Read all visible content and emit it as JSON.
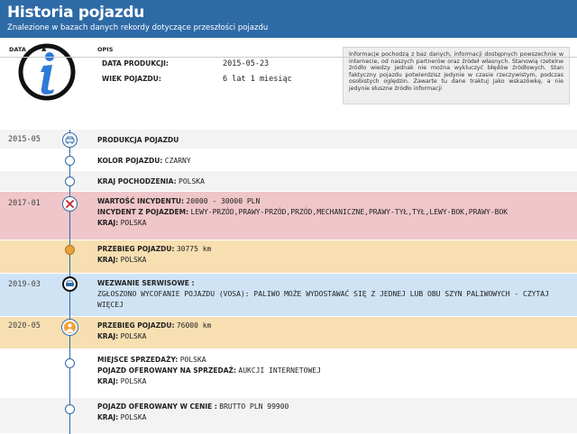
{
  "header": {
    "title": "Historia pojazdu",
    "subtitle": "Znalezione w bazach danych rekordy dotyczące przeszłości pojazdu"
  },
  "vehicle": {
    "production_label": "DATA PRODUKCJI:",
    "production_value": "2015-05-23",
    "age_label": "WIEK POJAZDU:",
    "age_value": "6 lat 1 miesiąc"
  },
  "notice": "Informacje pochodzą z baz danych, informacji dostępnych powszechnie w internecie, od naszych partnerów oraz źródeł własnych. Stanowią rzetelne źródło wiedzy jednak nie można wykluczyć błędów źródłowych. Stan faktyczny pojazdu potwierdzisz jedynie w czasie rzeczywistym, podczas osobistych oględzin. Zawarte tu dane traktuj jako wskazówkę, a nie jedynie słuszne źródło informacji",
  "table": {
    "col_date": "DATA",
    "sort_icon": "sort-up-icon",
    "col_desc": "OPIS"
  },
  "events": [
    {
      "date": "2015-05",
      "l1": "PRODUKCJA POJAZDU",
      "v1": ""
    },
    {
      "l1": "KOLOR POJAZDU:",
      "v1": "CZARNY"
    },
    {
      "l1": "KRAJ POCHODZENIA:",
      "v1": "POLSKA"
    },
    {
      "date": "2017-01",
      "l1": "WARTOŚĆ INCYDENTU:",
      "v1": "20000 - 30000 PLN",
      "l2": "INCYDENT Z POJAZDEM:",
      "v2": "LEWY-PRZÓD,PRAWY-PRZÓD,PRZÓD,MECHANICZNE,PRAWY-TYŁ,TYŁ,LEWY-BOK,PRAWY-BOK",
      "l3": "KRAJ:",
      "v3": "POLSKA"
    },
    {
      "l1": "PRZEBIEG POJAZDU:",
      "v1": "30775 km",
      "l2": "KRAJ:",
      "v2": "POLSKA"
    },
    {
      "date": "2019-03",
      "l1": "WEZWANIE SERWISOWE :",
      "v1": "",
      "text": "ZGŁOSZONO WYCOFANIE POJAZDU (VOSA): PALIWO MOŻE WYDOSTAWAĆ SIĘ Z JEDNEJ LUB OBU SZYN PALIWOWYCH - CZYTAJ WIĘCEJ"
    },
    {
      "date": "2020-05",
      "l1": "PRZEBIEG POJAZDU:",
      "v1": "76000 km",
      "l2": "KRAJ:",
      "v2": "POLSKA"
    },
    {
      "l1": "MIEJSCE SPRZEDAŻY:",
      "v1": "POLSKA",
      "l2": "POJAZD OFEROWANY NA SPRZEDAŻ:",
      "v2": "AUKCJI INTERNETOWEJ",
      "l3": "KRAJ:",
      "v3": "POLSKA"
    },
    {
      "l1": "POJAZD OFEROWANY W CENIE :",
      "v1": "BRUTTO PLN 99900",
      "l2": "KRAJ:",
      "v2": "POLSKA"
    }
  ],
  "colors": {
    "header": "#2e6aa6",
    "incident": "#efc6c9",
    "mileage": "#f7dfb1",
    "service": "#cfe3f5"
  }
}
